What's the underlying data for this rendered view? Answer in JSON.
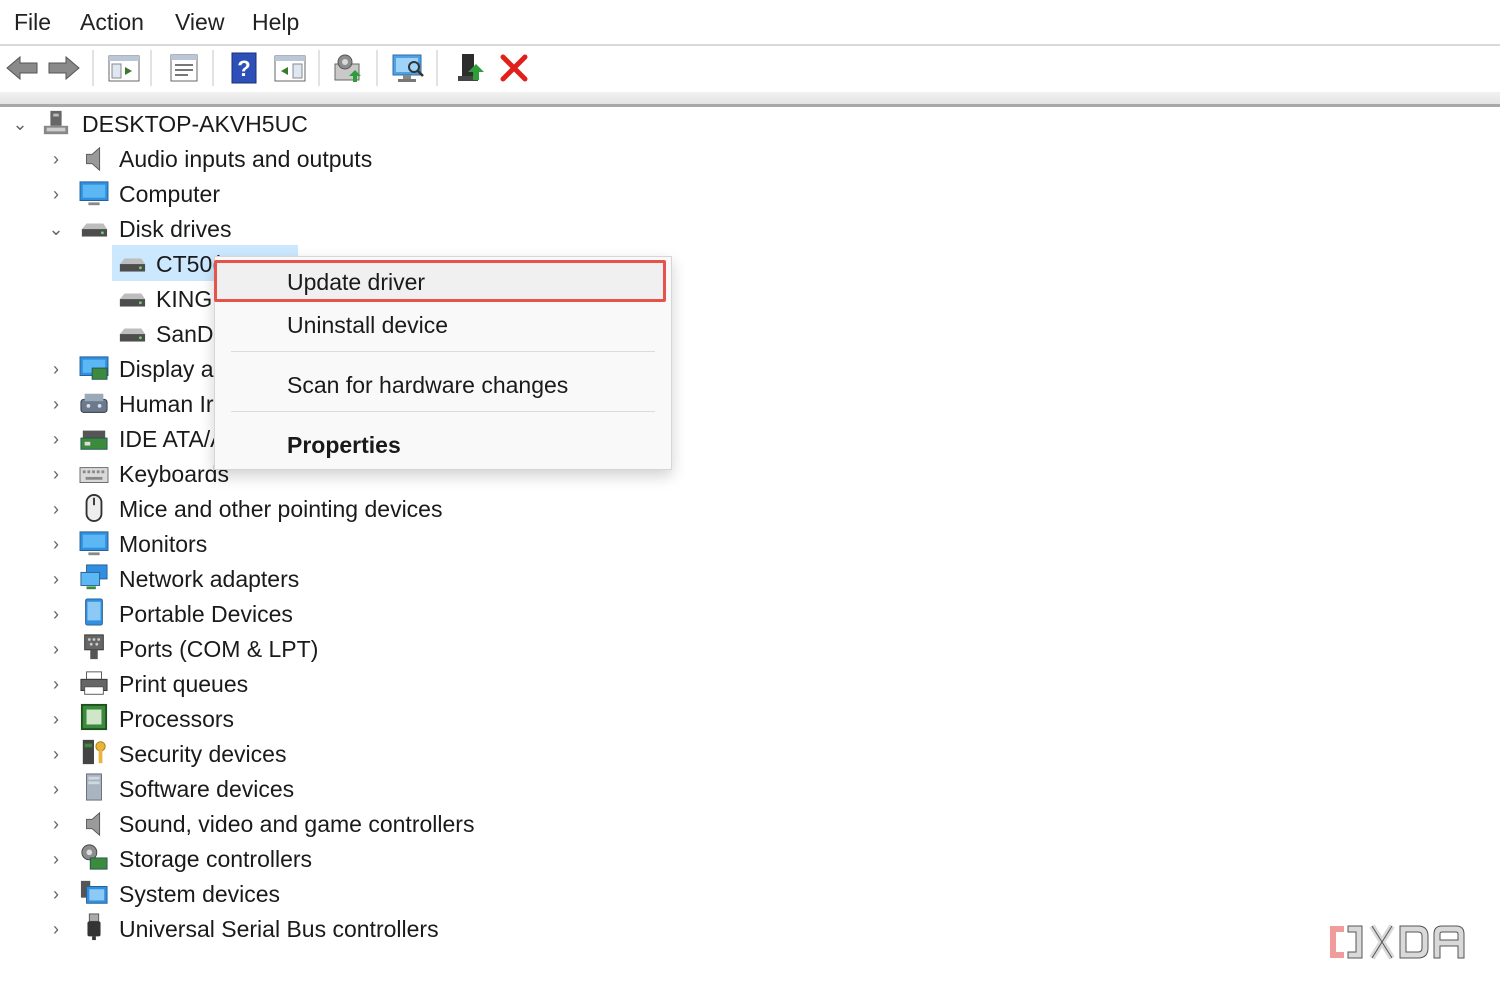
{
  "menubar": {
    "items": [
      "File",
      "Action",
      "View",
      "Help"
    ]
  },
  "toolbar": {
    "buttons": [
      "back-arrow-icon",
      "forward-arrow-icon",
      "show-hide-console-tree-icon",
      "properties-icon",
      "help-icon",
      "action-pane-icon",
      "update-driver-icon",
      "scan-hardware-icon",
      "enable-device-icon",
      "uninstall-device-icon"
    ]
  },
  "tree": {
    "root": "DESKTOP-AKVH5UC",
    "categories": [
      "Audio inputs and outputs",
      "Computer",
      "Disk drives",
      "CT50(",
      "KING:",
      "SanDi",
      "Display a",
      "Human Ir",
      "IDE ATA/A",
      "Keyboards",
      "Mice and other pointing devices",
      "Monitors",
      "Network adapters",
      "Portable Devices",
      "Ports (COM & LPT)",
      "Print queues",
      "Processors",
      "Security devices",
      "Software devices",
      "Sound, video and game controllers",
      "Storage controllers",
      "System devices",
      "Universal Serial Bus controllers"
    ]
  },
  "context_menu": {
    "items": [
      "Update driver",
      "Uninstall device",
      "Scan for hardware changes",
      "Properties"
    ]
  },
  "watermark": {
    "text": "XDA"
  },
  "colors": {
    "highlight": "#e5534b",
    "selection": "#cce8ff",
    "delete_red": "#e0201b"
  }
}
